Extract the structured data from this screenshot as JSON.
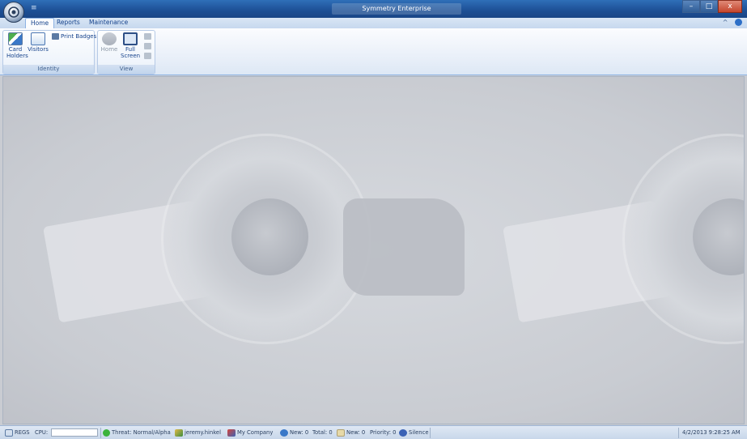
{
  "window": {
    "title": "Symmetry Enterprise",
    "qat_glyph": "≡",
    "buttons": {
      "minimize": "–",
      "maximize": "□",
      "close": "x"
    }
  },
  "tabs": [
    {
      "label": "Home",
      "active": true
    },
    {
      "label": "Reports",
      "active": false
    },
    {
      "label": "Maintenance",
      "active": false
    }
  ],
  "tab_right": {
    "collapse_glyph": "^"
  },
  "ribbon": {
    "identity": {
      "label": "Identity",
      "card_holders_line1": "Card",
      "card_holders_line2": "Holders",
      "visitors": "Visitors",
      "print_badges": "Print Badges"
    },
    "view": {
      "label": "View",
      "home": "Home",
      "full_screen_line1": "Full",
      "full_screen_line2": "Screen"
    }
  },
  "statusbar": {
    "regs": "REGS",
    "cpu": "CPU:",
    "threat": "Threat: Normal/Alpha",
    "user": "jeremy.hinkel",
    "company": "My Company",
    "new_count": "New: 0",
    "total_count": "Total: 0",
    "new_count2": "New: 0",
    "priority": "Priority: 0",
    "silence": "Silence",
    "datetime": "4/2/2013 9:28:25 AM"
  },
  "colors": {
    "accent": "#2f6fb8",
    "threat_ok": "#3cb33c",
    "ribbon_bg": "#e7eef8"
  }
}
